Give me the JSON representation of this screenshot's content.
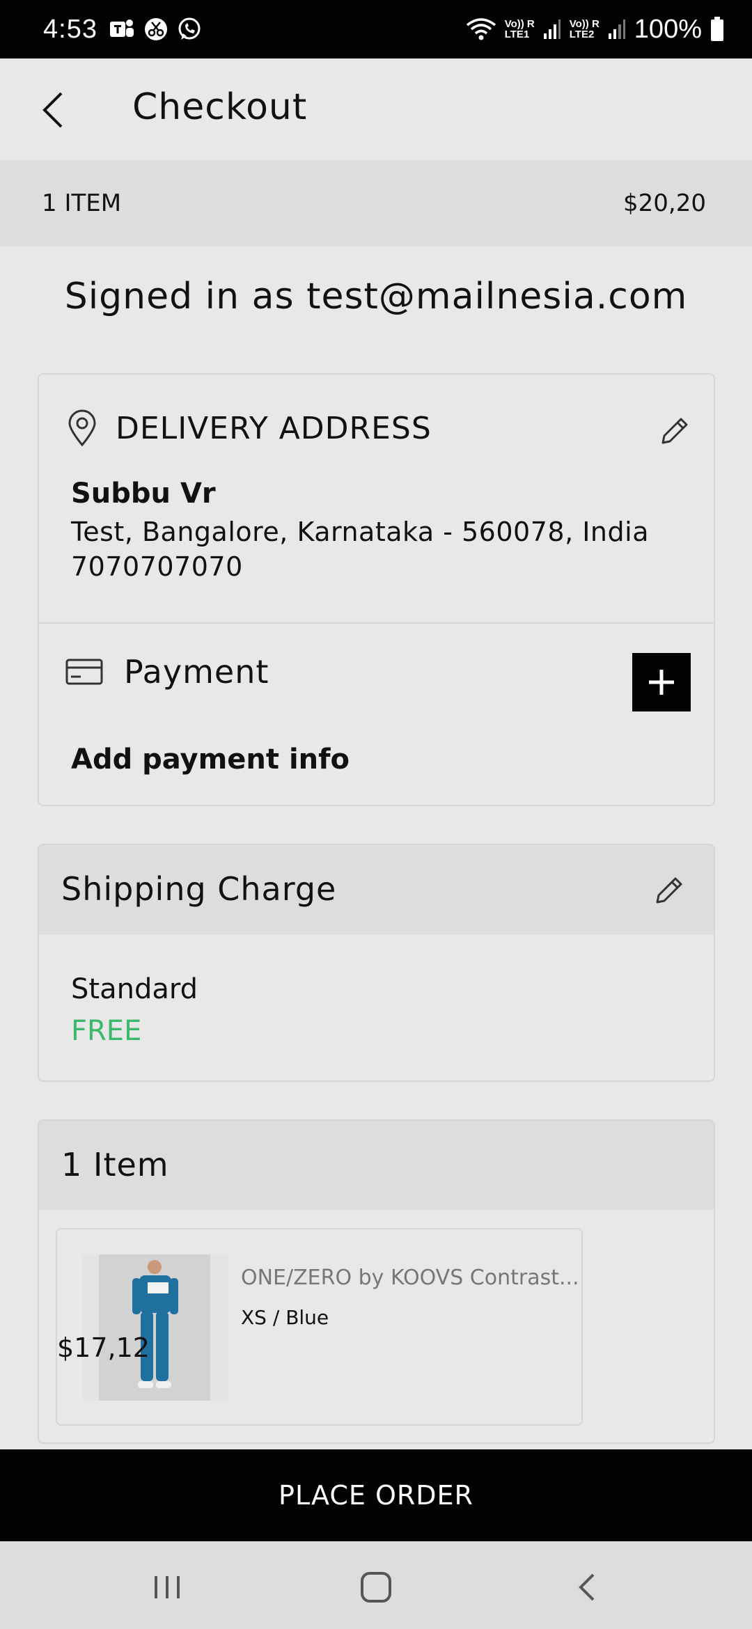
{
  "status_bar": {
    "time": "4:53",
    "net1": "Vo)) R\nLTE1",
    "net2": "Vo)) R\nLTE2",
    "battery": "100%"
  },
  "header": {
    "title": "Checkout"
  },
  "summary": {
    "items": "1 ITEM",
    "total": "$20,20"
  },
  "signed_in": "Signed in as test@mailnesia.com",
  "delivery": {
    "title": "DELIVERY ADDRESS",
    "name": "Subbu Vr",
    "address": "Test, Bangalore, Karnataka - 560078, India",
    "phone": "7070707070"
  },
  "payment": {
    "title": "Payment",
    "info": "Add payment info"
  },
  "shipping": {
    "title": "Shipping Charge",
    "method": "Standard",
    "cost": "FREE",
    "cost_color": "#3cb96a"
  },
  "items_section": {
    "title": "1 Item",
    "items": [
      {
        "name": "ONE/ZERO by KOOVS Contrast...",
        "variant": "XS / Blue",
        "price": "$17,12"
      }
    ]
  },
  "actions": {
    "place_order": "PLACE ORDER"
  },
  "nav_icons": [
    "recent-apps-icon",
    "home-icon",
    "back-nav-icon"
  ]
}
